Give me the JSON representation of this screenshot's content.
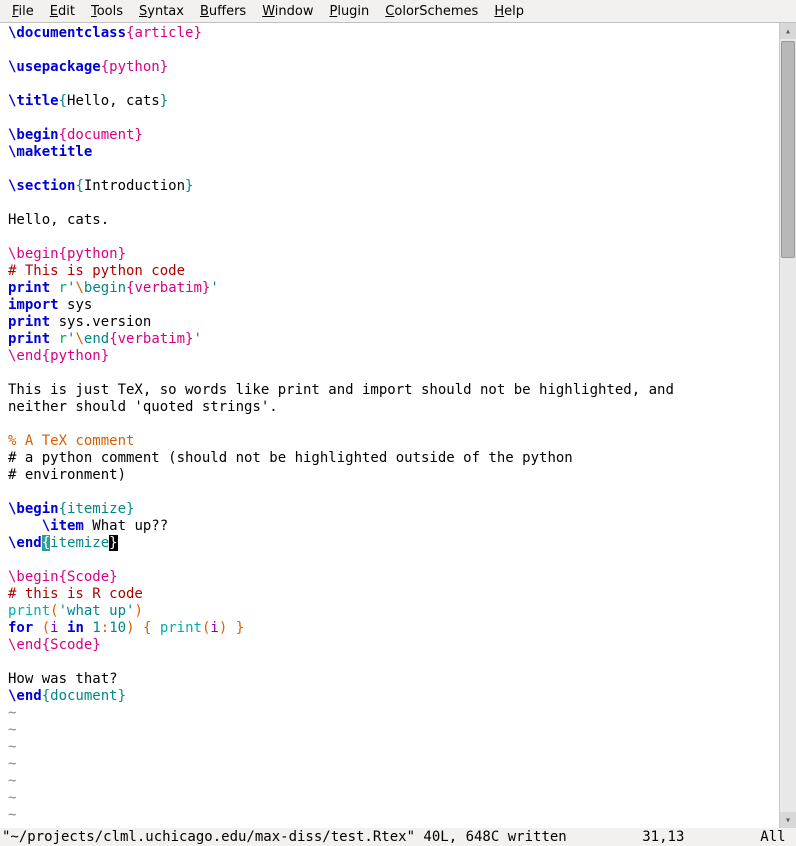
{
  "menu": {
    "file": "File",
    "edit": "Edit",
    "tools": "Tools",
    "syntax": "Syntax",
    "buffers": "Buffers",
    "window": "Window",
    "plugin": "Plugin",
    "colors": "ColorSchemes",
    "help": "Help"
  },
  "colors": {
    "blue": "#0000d7",
    "magenta": "#d70087",
    "teal": "#008787",
    "orange": "#d75f00",
    "darkred": "#af0000",
    "green": "#00af5f",
    "cyan": "#00afaf",
    "purple": "#8700af"
  },
  "code": {
    "l1_cmd": "\\documentclass",
    "l1_arg": "{article}",
    "l3_cmd": "\\usepackage",
    "l3_arg": "{python}",
    "l5_cmd": "\\title",
    "l5_brace1": "{",
    "l5_text": "Hello, cats",
    "l5_brace2": "}",
    "l7_cmd": "\\begin",
    "l7_arg": "{document}",
    "l8_cmd": "\\maketitle",
    "l10_cmd": "\\section",
    "l10_brace1": "{",
    "l10_text": "Introduction",
    "l10_brace2": "}",
    "l12": "Hello, cats.",
    "l14_cmd": "\\begin",
    "l14_arg": "{python}",
    "l15": "# This is python code",
    "l16_kw": "print",
    "l16_sp": " ",
    "l16_r": "r",
    "l16_q1": "'",
    "l16_bs": "\\",
    "l16_beg": "begin",
    "l16_verb": "{verbatim}",
    "l16_q2": "'",
    "l17_kw": "import",
    "l17_sp": " ",
    "l17_arg": "sys",
    "l18_kw": "print",
    "l18_sp": " ",
    "l18_arg": "sys.version",
    "l19_kw": "print",
    "l19_sp": " ",
    "l19_r": "r",
    "l19_q1": "'",
    "l19_bs": "\\",
    "l19_end": "end",
    "l19_verb": "{verbatim}",
    "l19_q2": "'",
    "l20_cmd": "\\end",
    "l20_arg": "{python}",
    "l22": "This is just TeX, so words like print and import should not be highlighted, and",
    "l23": "neither should 'quoted strings'.",
    "l25": "% A TeX comment",
    "l26": "# a python comment (should not be highlighted outside of the python",
    "l27": "# environment)",
    "l29_cmd": "\\begin",
    "l29_arg": "{itemize}",
    "l30_indent": "    ",
    "l30_cmd": "\\item",
    "l30_text": " What up??",
    "l31_cmd": "\\end",
    "l31_b1": "{",
    "l31_arg": "itemize",
    "l31_b2": "}",
    "l33_cmd": "\\begin",
    "l33_arg": "{Scode}",
    "l34": "# this is R code",
    "l35_fn": "print",
    "l35_p1": "(",
    "l35_str": "'what up'",
    "l35_p2": ")",
    "l36_for": "for",
    "l36_sp1": " ",
    "l36_p1": "(",
    "l36_i1": "i",
    "l36_sp2": " ",
    "l36_in": "in",
    "l36_sp3": " ",
    "l36_r1": "1",
    "l36_col": ":",
    "l36_r2": "10",
    "l36_p2": ")",
    "l36_sp4": " ",
    "l36_b1": "{",
    "l36_sp5": " ",
    "l36_fn": "print",
    "l36_p3": "(",
    "l36_i2": "i",
    "l36_p4": ")",
    "l36_sp6": " ",
    "l36_b2": "}",
    "l37_cmd": "\\end",
    "l37_arg": "{Scode}",
    "l39": "How was that?",
    "l40_cmd": "\\end",
    "l40_arg": "{document}",
    "tilde": "~"
  },
  "status": {
    "left": "\"~/projects/clml.uchicago.edu/max-diss/test.Rtex\" 40L, 648C written",
    "pos": "31,13",
    "pct": "All"
  }
}
